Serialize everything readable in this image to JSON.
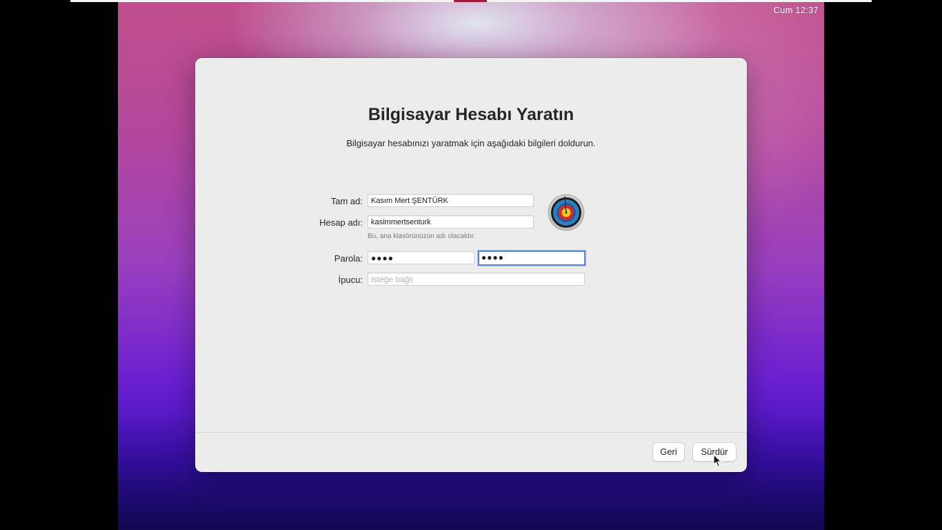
{
  "menubar": {
    "clock": "Cum 12:37"
  },
  "dialog": {
    "title": "Bilgisayar Hesabı Yaratın",
    "subtitle": "Bilgisayar hesabınızı yaratmak için aşağıdaki bilgileri doldurun.",
    "full_name": {
      "label": "Tam ad:",
      "value": "Kasım Mert ŞENTÜRK"
    },
    "account_name": {
      "label": "Hesap adı:",
      "value": "kasimmertsenturk",
      "hint": "Bu, ana klasörünüzün adı olacaktır."
    },
    "password": {
      "label": "Parola:",
      "value": "●●●●",
      "verify_value": "●●●●"
    },
    "hint_field": {
      "label": "İpucu:",
      "placeholder": "isteğe bağlı"
    },
    "avatar_icon": "archery-target-icon",
    "buttons": {
      "back": "Geri",
      "continue": "Sürdür"
    }
  },
  "colors": {
    "focus_ring": "#5b87d6",
    "dialog_bg": "#ececec"
  }
}
